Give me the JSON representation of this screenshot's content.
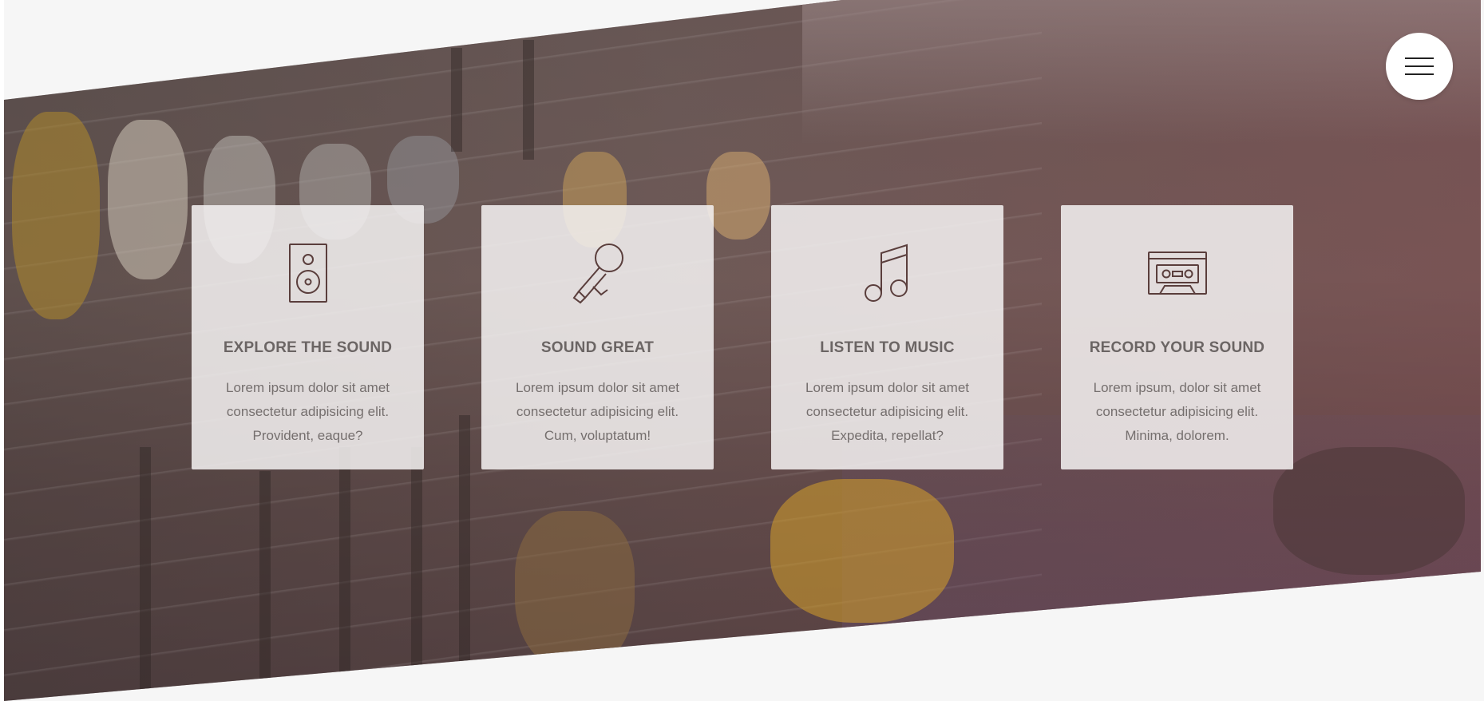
{
  "menu": {
    "icon": "hamburger-menu-icon"
  },
  "colors": {
    "card_background": "#f5f2f2",
    "title_text": "#6b6564",
    "body_text": "#756f6e",
    "icon_stroke": "#5a3e3c"
  },
  "features": [
    {
      "icon": "speaker-icon",
      "title": "EXPLORE THE SOUND",
      "desc_lines": [
        "Lorem ipsum dolor sit amet",
        "consectetur adipisicing elit.",
        "Provident, eaque?"
      ]
    },
    {
      "icon": "microphone-icon",
      "title": "SOUND GREAT",
      "desc_lines": [
        "Lorem ipsum dolor sit amet",
        "consectetur adipisicing elit.",
        "Cum, voluptatum!"
      ]
    },
    {
      "icon": "music-note-icon",
      "title": "LISTEN TO MUSIC",
      "desc_lines": [
        "Lorem ipsum dolor sit amet",
        "consectetur adipisicing elit.",
        "Expedita, repellat?"
      ]
    },
    {
      "icon": "cassette-tape-icon",
      "title": "RECORD YOUR SOUND",
      "desc_lines": [
        "Lorem ipsum, dolor sit amet",
        "consectetur adipisicing elit.",
        "Minima, dolorem."
      ]
    }
  ]
}
